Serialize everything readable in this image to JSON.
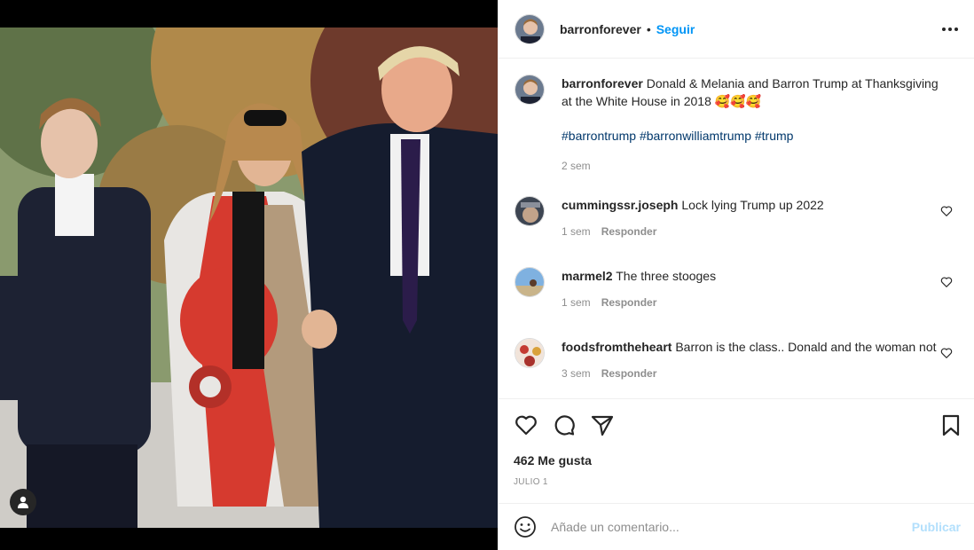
{
  "post": {
    "username": "barronforever",
    "follow_label": "Seguir",
    "separator": "•",
    "caption": "Donald & Melania and Barron Trump at Thanksgiving at the White House in 2018 🥰🥰🥰",
    "hashtags": [
      "#barrontrump",
      "#barronwilliamtrump",
      "#trump"
    ],
    "caption_time": "2 sem",
    "likes_text": "462 Me gusta",
    "date": "JULIO 1"
  },
  "comments": [
    {
      "user": "cummingssr.joseph",
      "text": "Lock lying Trump up 2022",
      "time": "1 sem",
      "reply": "Responder"
    },
    {
      "user": "marmel2",
      "text": "The three stooges",
      "time": "1 sem",
      "reply": "Responder"
    },
    {
      "user": "foodsfromtheheart",
      "text": "Barron is the class.. Donald and the woman not",
      "time": "3 sem",
      "reply": "Responder"
    }
  ],
  "composer": {
    "placeholder": "Añade un comentario...",
    "publish_label": "Publicar"
  },
  "icons": {
    "more": "more-options-icon",
    "like": "heart-icon",
    "comment": "comment-icon",
    "share": "send-icon",
    "save": "bookmark-icon",
    "emoji": "emoji-icon",
    "tag": "user-tag-icon"
  },
  "colors": {
    "accent": "#0095f6",
    "hashtag": "#00376b",
    "muted": "#8e8e8e",
    "publish_disabled": "#b2dffc"
  }
}
